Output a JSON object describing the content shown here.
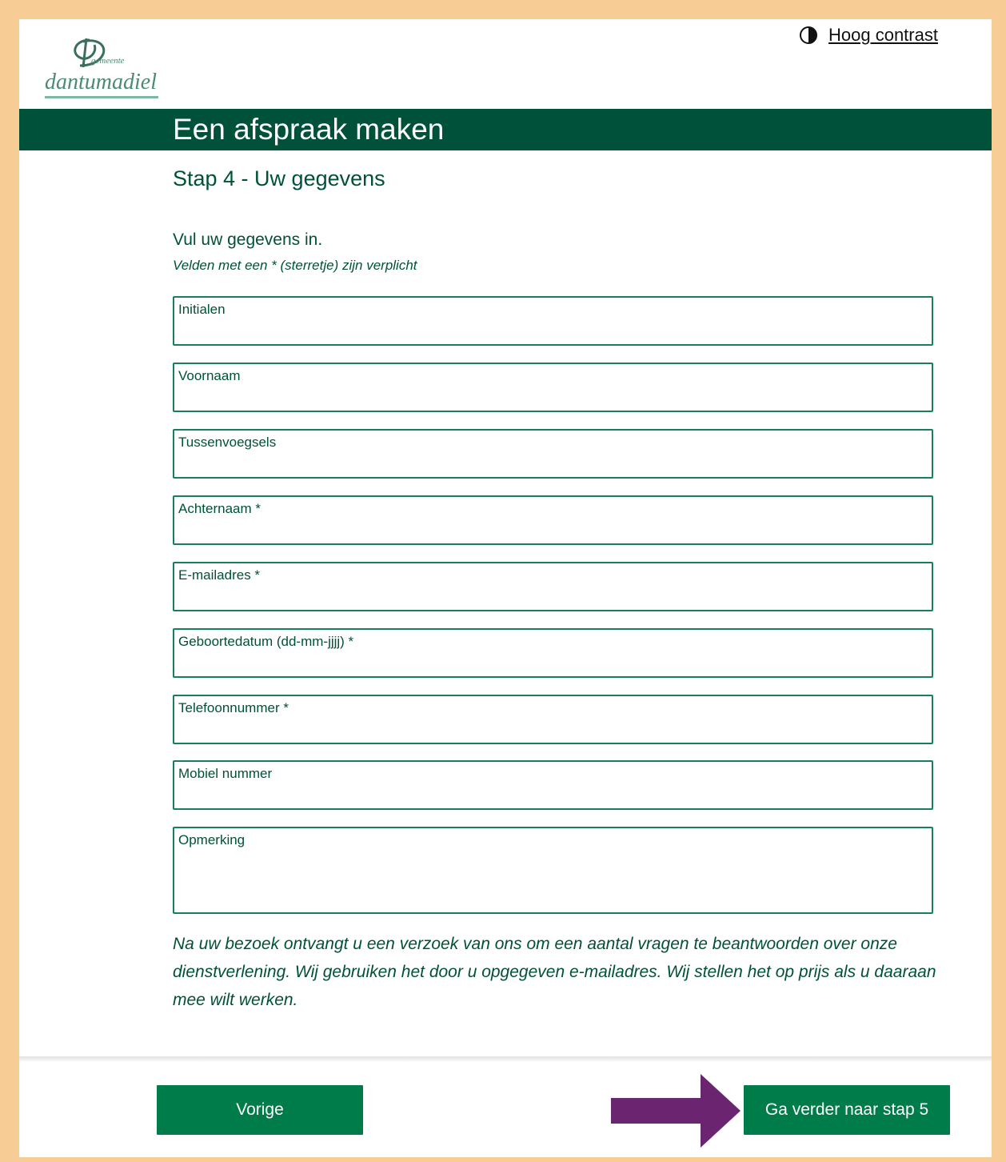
{
  "header": {
    "logo_text": "dantumadiel",
    "logo_small": "gemeente",
    "contrast_icon": "half-circle-icon",
    "contrast_label": "Hoog contrast"
  },
  "banner": {
    "title": "Een afspraak maken"
  },
  "step": {
    "title": "Stap 4 - Uw gegevens",
    "intro": "Vul uw gegevens in.",
    "required_note": "Velden met een * (sterretje) zijn verplicht"
  },
  "fields": [
    {
      "label": "Initialen",
      "value": ""
    },
    {
      "label": "Voornaam",
      "value": ""
    },
    {
      "label": "Tussenvoegsels",
      "value": ""
    },
    {
      "label": "Achternaam *",
      "value": ""
    },
    {
      "label": "E-mailadres *",
      "value": ""
    },
    {
      "label": "Geboortedatum (dd-mm-jjjj) *",
      "value": ""
    },
    {
      "label": "Telefoonnummer *",
      "value": ""
    },
    {
      "label": "Mobiel nummer",
      "value": ""
    },
    {
      "label": "Opmerking",
      "value": ""
    }
  ],
  "notice": "Na uw bezoek ontvangt u een verzoek van ons om een aantal vragen te beantwoorden over onze dienstverlening. Wij gebruiken het door u opgegeven e-mailadres. Wij stellen het op prijs als u daaraan mee wilt werken.",
  "buttons": {
    "previous": "Vorige",
    "next": "Ga verder naar stap 5"
  },
  "colors": {
    "brand_dark": "#005139",
    "button": "#007b4a",
    "annotation_arrow": "#6b2470",
    "page_border": "#f8cd95"
  }
}
